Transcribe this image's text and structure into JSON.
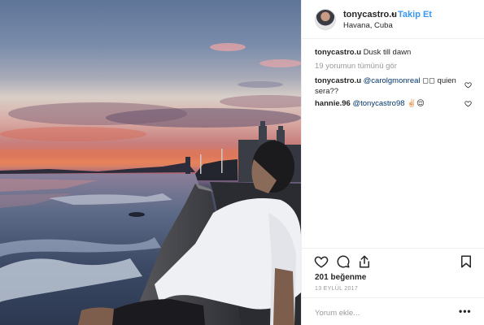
{
  "post": {
    "username": "tonycastro.u",
    "separator": "•",
    "follow_label": "Takip Et",
    "location": "Havana, Cuba"
  },
  "caption": {
    "username": "tonycastro.u",
    "text": "Dusk till dawn"
  },
  "view_all_comments": "19 yorumun tümünü gör",
  "comments": [
    {
      "username": "tonycastro.u",
      "mention": "@carolgmonreal",
      "text": " ◻◻ quien sera??"
    },
    {
      "username": "hannie.96",
      "mention": "@tonycastro98",
      "text": " ✌🏻😌"
    }
  ],
  "likes": "201 beğenme",
  "date": "13 EYLÜL 2017",
  "add_comment_placeholder": "Yorum ekle...",
  "more_label": "•••",
  "icons": {
    "like": "heart-icon",
    "comment": "comment-icon",
    "share": "share-icon",
    "save": "bookmark-icon",
    "comment_like": "heart-icon",
    "options": "more-options-icon"
  },
  "colors": {
    "link_blue": "#3897f0",
    "mention_blue": "#003569",
    "muted_gray": "#999999",
    "text": "#262626"
  }
}
